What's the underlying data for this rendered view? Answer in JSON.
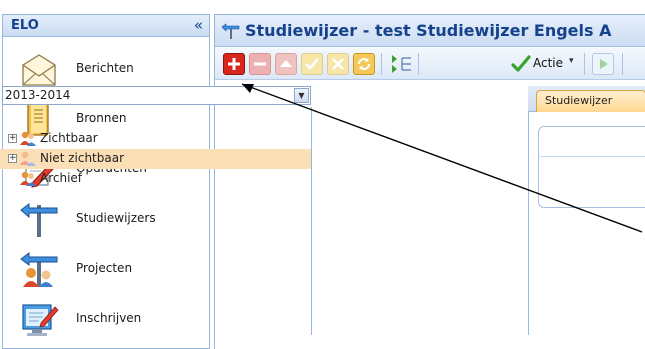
{
  "elo_panel": {
    "title": "ELO",
    "collapse_glyph": "«",
    "items": [
      {
        "label": "Berichten",
        "icon": "envelope-icon"
      },
      {
        "label": "Bronnen",
        "icon": "book-icon"
      },
      {
        "label": "Opdrachten",
        "icon": "document-pencil-icon"
      },
      {
        "label": "Studiewijzers",
        "icon": "signpost-icon"
      },
      {
        "label": "Projecten",
        "icon": "project-people-icon"
      },
      {
        "label": "Inschrijven",
        "icon": "register-form-icon"
      }
    ]
  },
  "window": {
    "title": "Studiewijzer - test Studiewijzer Engels A"
  },
  "toolbar": {
    "actie_label": "Actie",
    "actie_caret": "▾",
    "buttons": [
      "add-icon",
      "remove-icon",
      "move-up-icon",
      "approve-icon",
      "delete-icon",
      "refresh-icon",
      "tree-structure-icon",
      "checkmark-icon",
      "play-icon"
    ]
  },
  "year_select": {
    "value": "2013-2014",
    "arrow": "▼"
  },
  "tree": {
    "items": [
      {
        "label": "Zichtbaar",
        "expander": "+",
        "selected": false
      },
      {
        "label": "Niet zichtbaar",
        "expander": "+",
        "selected": true
      },
      {
        "label": "Archief",
        "expander": "",
        "selected": false
      }
    ]
  },
  "tabs": {
    "active_label": "Studiewijzer"
  },
  "colors": {
    "accent": "#15428b",
    "selected_row": "#fbdfb6",
    "add_button": "#d9261c",
    "checkmark": "#3aa12c"
  }
}
